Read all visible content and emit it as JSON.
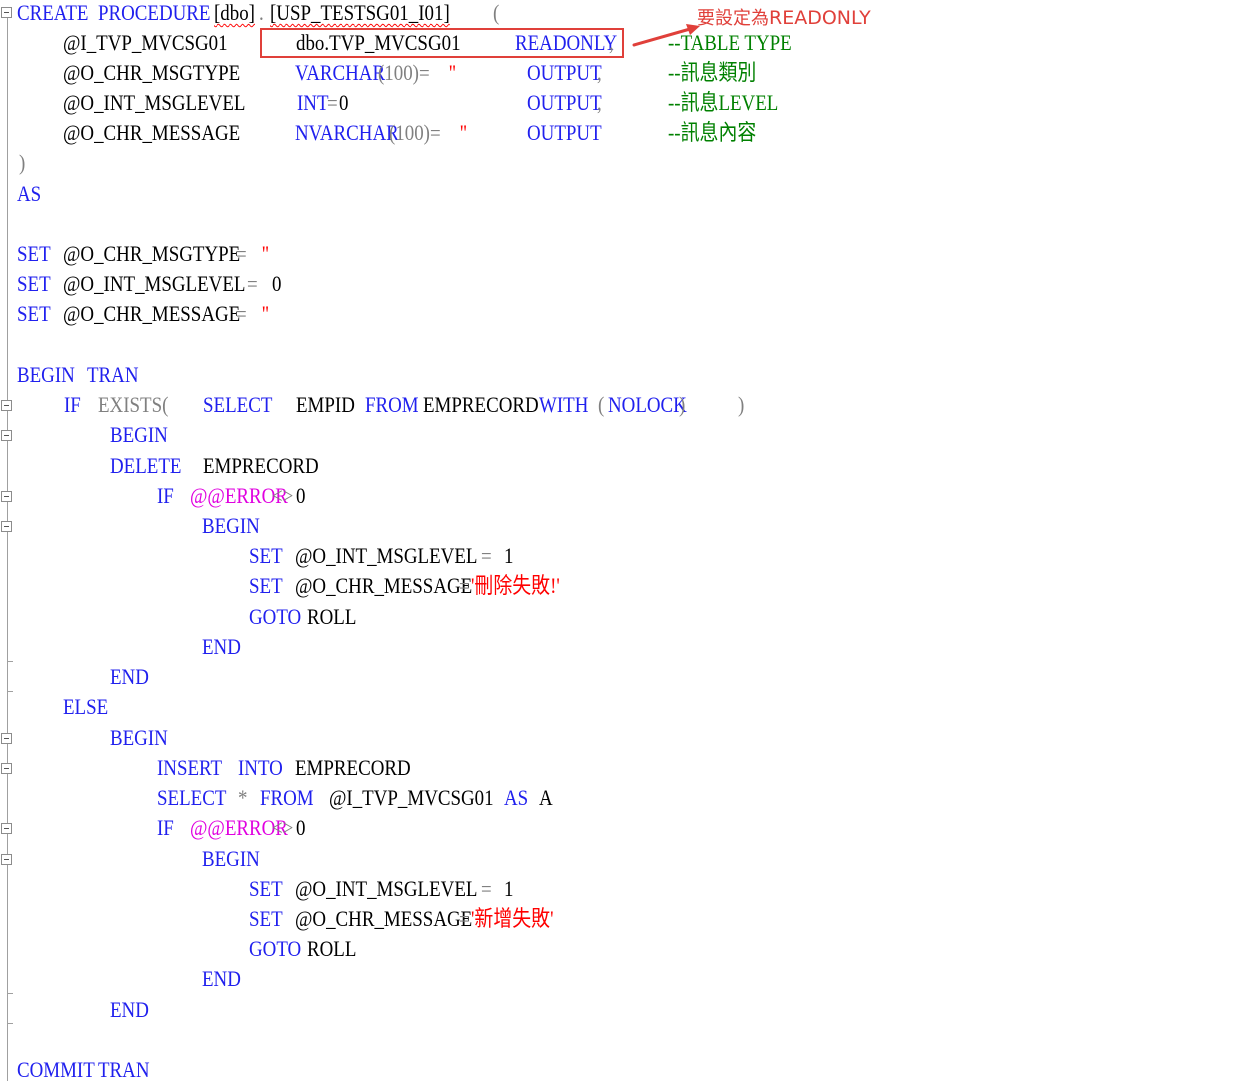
{
  "callout": {
    "zh": "要設定為",
    "en": "READONLY"
  },
  "colors": {
    "keyword": "#2020ee",
    "system_function": "#e000e0",
    "operator": "#808080",
    "comment": "#008000",
    "string": "#ff0000",
    "callout": "#e0403a"
  },
  "code": {
    "l1": {
      "create": "CREATE",
      "procedure": "PROCEDURE",
      "dbo": "[dbo]",
      "dot": ".",
      "name": "[USP_TESTSG01_I01]",
      "paren": "("
    },
    "l2": {
      "param": "@I_TVP_MVCSG01",
      "type": "dbo.TVP_MVCSG01",
      "readonly": "READONLY",
      "comma": ",",
      "comment": "--TABLE TYPE"
    },
    "l3": {
      "param": "@O_CHR_MSGTYPE",
      "type": "VARCHAR",
      "size": "(100)=",
      "str": "''",
      "output": "OUTPUT",
      "comma": ",",
      "comment": "--訊息類別"
    },
    "l4": {
      "param": "@O_INT_MSGLEVEL",
      "type": "INT",
      "eq": "=",
      "zero": "0",
      "output": "OUTPUT",
      "comma": ",",
      "comment": "--訊息LEVEL"
    },
    "l5": {
      "param": "@O_CHR_MESSAGE",
      "type": "NVARCHAR",
      "size": "(100)=",
      "str": "''",
      "output": "OUTPUT",
      "comment": "--訊息內容"
    },
    "l6": {
      "close": ")"
    },
    "l7": {
      "as": "AS"
    },
    "l9": {
      "set": "SET",
      "var": "@O_CHR_MSGTYPE",
      "eq": "=",
      "str": "''"
    },
    "l10": {
      "set": "SET",
      "var": "@O_INT_MSGLEVEL",
      "eq": "=",
      "zero": "0"
    },
    "l11": {
      "set": "SET",
      "var": "@O_CHR_MESSAGE",
      "eq": "=",
      "str": "''"
    },
    "l13": {
      "begin": "BEGIN",
      "tran": "TRAN"
    },
    "l14": {
      "if": "IF",
      "exists": "EXISTS(",
      "select": "SELECT",
      "col": "EMPID",
      "from": "FROM",
      "table": "EMPRECORD",
      "with": "WITH",
      "open": "(",
      "nolock": "NOLOCK",
      "close1": ")",
      "close2": ")"
    },
    "l15": {
      "begin": "BEGIN"
    },
    "l16": {
      "delete": "DELETE",
      "table": "EMPRECORD"
    },
    "l17": {
      "if": "IF",
      "error": "@@ERROR",
      "op": "<>",
      "zero": "0"
    },
    "l18": {
      "begin": "BEGIN"
    },
    "l19": {
      "set": "SET",
      "var": "@O_INT_MSGLEVEL",
      "eq": "=",
      "one": "1"
    },
    "l20": {
      "set": "SET",
      "var": "@O_CHR_MESSAGE",
      "eq": "=",
      "str": "'刪除失敗!'"
    },
    "l21": {
      "goto": "GOTO",
      "label": "ROLL"
    },
    "l22": {
      "end": "END"
    },
    "l23": {
      "end": "END"
    },
    "l24": {
      "else": "ELSE"
    },
    "l25": {
      "begin": "BEGIN"
    },
    "l26": {
      "insert": "INSERT",
      "into": "INTO",
      "table": "EMPRECORD"
    },
    "l27": {
      "select": "SELECT",
      "star": "*",
      "from": "FROM",
      "param": "@I_TVP_MVCSG01",
      "as": "AS",
      "alias": "A"
    },
    "l28": {
      "if": "IF",
      "error": "@@ERROR",
      "op": "<>",
      "zero": "0"
    },
    "l29": {
      "begin": "BEGIN"
    },
    "l30": {
      "set": "SET",
      "var": "@O_INT_MSGLEVEL",
      "eq": "=",
      "one": "1"
    },
    "l31": {
      "set": "SET",
      "var": "@O_CHR_MESSAGE",
      "eq": "=",
      "str": "'新增失敗'"
    },
    "l32": {
      "goto": "GOTO",
      "label": "ROLL"
    },
    "l33": {
      "end": "END"
    },
    "l34": {
      "end": "END"
    },
    "l36": {
      "commit": "COMMIT",
      "tran": "TRAN"
    }
  }
}
